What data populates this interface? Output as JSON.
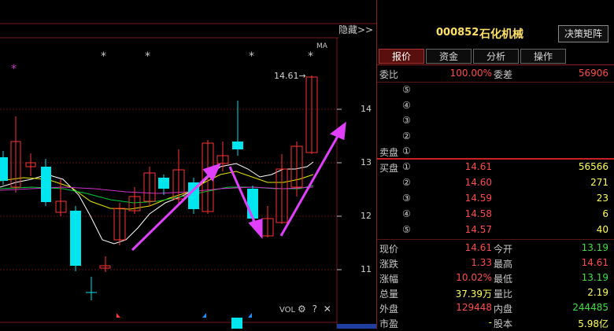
{
  "chart": {
    "hide_label": "隐藏>>",
    "ma_label": "MA",
    "price_marker": "14.61→",
    "y_ticks": [
      "14",
      "13",
      "12",
      "11"
    ],
    "vol_label": "VOL",
    "vol_icons": "⚙ ? ✕",
    "star": "*"
  },
  "quote": {
    "code": "000852",
    "name": "石化机械",
    "decision_button": "决策矩阵",
    "tabs": [
      "报价",
      "资金",
      "分析",
      "操作"
    ],
    "weibi": {
      "label": "委比",
      "value": "100.00%",
      "label2": "委差",
      "value2": "56906"
    },
    "sell": [
      {
        "label": "",
        "level": "⑤",
        "price": "",
        "vol": ""
      },
      {
        "label": "",
        "level": "④",
        "price": "",
        "vol": ""
      },
      {
        "label": "",
        "level": "③",
        "price": "",
        "vol": ""
      },
      {
        "label": "",
        "level": "②",
        "price": "",
        "vol": ""
      },
      {
        "label": "卖盘",
        "level": "①",
        "price": "",
        "vol": ""
      }
    ],
    "buy": [
      {
        "label": "买盘",
        "level": "①",
        "price": "14.61",
        "vol": "56566"
      },
      {
        "label": "",
        "level": "②",
        "price": "14.60",
        "vol": "271"
      },
      {
        "label": "",
        "level": "③",
        "price": "14.59",
        "vol": "23"
      },
      {
        "label": "",
        "level": "④",
        "price": "14.58",
        "vol": "6"
      },
      {
        "label": "",
        "level": "⑤",
        "price": "14.57",
        "vol": "40"
      }
    ],
    "stats": [
      {
        "l1": "现价",
        "v1": "14.61",
        "c1": "red",
        "l2": "今开",
        "v2": "13.19",
        "c2": "grn"
      },
      {
        "l1": "涨跌",
        "v1": "1.33",
        "c1": "red",
        "l2": "最高",
        "v2": "14.61",
        "c2": "red"
      },
      {
        "l1": "涨幅",
        "v1": "10.02%",
        "c1": "red",
        "l2": "最低",
        "v2": "13.19",
        "c2": "grn"
      },
      {
        "l1": "总量",
        "v1": "37.39万",
        "c1": "yel",
        "l2": "量比",
        "v2": "2.19",
        "c2": "yel"
      },
      {
        "l1": "外盘",
        "v1": "129448",
        "c1": "red",
        "l2": "内盘",
        "v2": "244485",
        "c2": "grn"
      },
      {
        "l1": "市盈",
        "v1": "-",
        "c1": "yel",
        "l2": "股本",
        "v2": "5.98亿",
        "c2": "yel"
      }
    ]
  },
  "colors": {
    "up": "#ff3333",
    "down": "#00e5ee",
    "arrow": "#e040fb",
    "border": "#8a1f1f"
  }
}
